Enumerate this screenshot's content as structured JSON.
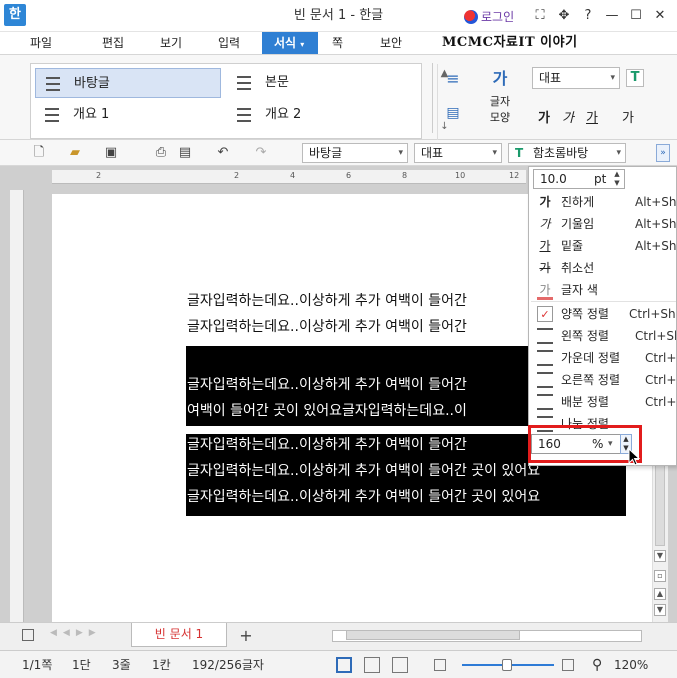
{
  "titlebar": {
    "logo": "한",
    "title": "빈 문서 1 - 한글",
    "login": "로그인",
    "icons": [
      "collapse-icon",
      "resize-icon",
      "help-icon",
      "minimize-icon",
      "maximize-icon",
      "close-icon"
    ],
    "glyphs": [
      "⛶",
      "✥",
      "?",
      "—",
      "☐",
      "✕"
    ]
  },
  "menubar": {
    "items": [
      "파일",
      "편집",
      "보기",
      "입력",
      "서식",
      "쪽",
      "보안"
    ],
    "active": "서식",
    "watermark": "MCMC자료IT 이야기"
  },
  "ribbon": {
    "styles": [
      "바탕글",
      "본문",
      "개요 1",
      "개요 2"
    ],
    "selected_style": "바탕글",
    "char_shape_label_1": "글자",
    "char_shape_label_2": "모양",
    "font_category": "대표",
    "format_buttons": [
      "가",
      "가",
      "가",
      "가"
    ]
  },
  "toolbar": {
    "style_combo": "바탕글",
    "font_category_combo": "대표",
    "font_combo": "함초롬바탕"
  },
  "ruler": {
    "ticks": [
      "2",
      "2",
      "4",
      "6",
      "8",
      "10",
      "12"
    ]
  },
  "document": {
    "lines": [
      {
        "text": "글자입력하는데요..이상하게 추가 여백이 들어간",
        "selected": false
      },
      {
        "text": "글자입력하는데요..이상하게 추가 여백이 들어간",
        "selected": false
      },
      {
        "text": "글자입력하는데요..이상하게 추가 여백이 들어간",
        "selected": true
      },
      {
        "text": "여백이 들어간 곳이 있어요글자입력하는데요..이",
        "selected": true
      },
      {
        "text": "글자입력하는데요..이상하게 추가 여백이 들어간",
        "selected": true
      },
      {
        "text": "글자입력하는데요..이상하게 추가 여백이 들어간 곳이 있어요",
        "selected": true
      },
      {
        "text": "글자입력하는데요..이상하게 추가 여백이 들어간 곳이 있어요",
        "selected": true
      }
    ]
  },
  "dropdown": {
    "font_size": "10.0",
    "font_size_unit": "pt",
    "char_items": [
      {
        "icon": "가",
        "label": "진하게",
        "shortcut": "Alt+Shift"
      },
      {
        "icon": "가",
        "label": "기울임",
        "shortcut": "Alt+Shift"
      },
      {
        "icon": "가",
        "label": "밑줄",
        "shortcut": "Alt+Shift"
      },
      {
        "icon": "가",
        "label": "취소선",
        "shortcut": ""
      },
      {
        "icon": "가",
        "label": "글자 색",
        "shortcut": ""
      }
    ],
    "align_items": [
      {
        "label": "양쪽 정렬",
        "shortcut": "Ctrl+Shift"
      },
      {
        "label": "왼쪽 정렬",
        "shortcut": "Ctrl+Shift"
      },
      {
        "label": "가운데 정렬",
        "shortcut": "Ctrl+Shift"
      },
      {
        "label": "오른쪽 정렬",
        "shortcut": "Ctrl+Shift"
      },
      {
        "label": "배분 정렬",
        "shortcut": "Ctrl+Shift"
      },
      {
        "label": "나눔 정렬",
        "shortcut": ""
      }
    ],
    "line_spacing": "160",
    "line_spacing_unit": "%"
  },
  "tabs": {
    "doc_tab": "빈 문서 1",
    "add": "+"
  },
  "status": {
    "page": "1/1쪽",
    "section": "1단",
    "line": "3줄",
    "column": "1칸",
    "chars": "192/256글자",
    "zoom": "120%"
  }
}
